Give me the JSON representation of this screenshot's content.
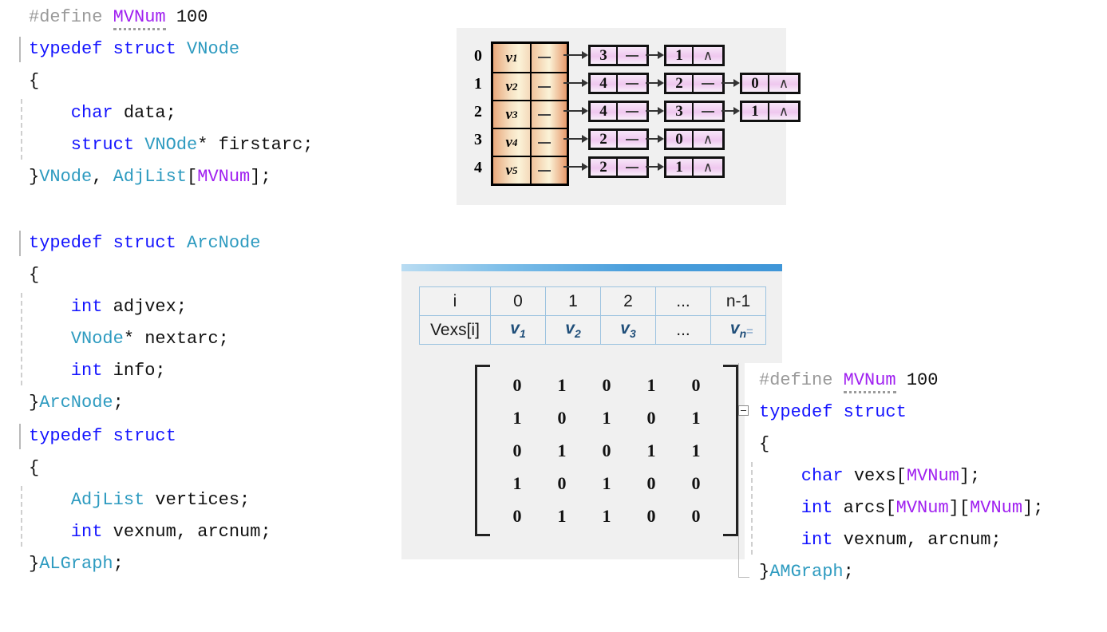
{
  "code_blocks": {
    "vnode": {
      "id": "vnode-struct",
      "lines": [
        {
          "tokens": [
            {
              "t": "#define ",
              "c": "pp"
            },
            {
              "t": "MVNum",
              "c": "macro squig"
            },
            {
              "t": " 100",
              "c": "num"
            }
          ]
        },
        {
          "tokens": [
            {
              "t": "typedef struct ",
              "c": "kw"
            },
            {
              "t": "VNode",
              "c": "typ"
            }
          ],
          "gutter": "bar"
        },
        {
          "tokens": [
            {
              "t": "{",
              "c": "plain"
            }
          ]
        },
        {
          "tokens": [
            {
              "t": "    char",
              "c": "kw"
            },
            {
              "t": " data;",
              "c": "plain"
            }
          ],
          "gutter": "guide"
        },
        {
          "tokens": [
            {
              "t": "    struct ",
              "c": "kw"
            },
            {
              "t": "VNOde",
              "c": "typ"
            },
            {
              "t": "* firstarc;",
              "c": "plain"
            }
          ],
          "gutter": "guide"
        },
        {
          "tokens": [
            {
              "t": "}",
              "c": "plain"
            },
            {
              "t": "VNode",
              "c": "typ"
            },
            {
              "t": ", ",
              "c": "plain"
            },
            {
              "t": "AdjList",
              "c": "typ"
            },
            {
              "t": "[",
              "c": "plain"
            },
            {
              "t": "MVNum",
              "c": "macro"
            },
            {
              "t": "];",
              "c": "plain"
            }
          ]
        }
      ]
    },
    "arcnode": {
      "id": "arcnode-struct",
      "lines": [
        {
          "tokens": [
            {
              "t": "typedef struct ",
              "c": "kw"
            },
            {
              "t": "ArcNode",
              "c": "typ"
            }
          ],
          "gutter": "bar"
        },
        {
          "tokens": [
            {
              "t": "{",
              "c": "plain"
            }
          ]
        },
        {
          "tokens": [
            {
              "t": "    int",
              "c": "kw"
            },
            {
              "t": " adjvex;",
              "c": "plain"
            }
          ],
          "gutter": "guide"
        },
        {
          "tokens": [
            {
              "t": "    ",
              "c": "plain"
            },
            {
              "t": "VNode",
              "c": "typ"
            },
            {
              "t": "* nextarc;",
              "c": "plain"
            }
          ],
          "gutter": "guide"
        },
        {
          "tokens": [
            {
              "t": "    int",
              "c": "kw"
            },
            {
              "t": " info;",
              "c": "plain"
            }
          ],
          "gutter": "guide"
        },
        {
          "tokens": [
            {
              "t": "}",
              "c": "plain"
            },
            {
              "t": "ArcNode",
              "c": "typ"
            },
            {
              "t": ";",
              "c": "plain"
            }
          ]
        }
      ]
    },
    "algraph": {
      "id": "algraph-struct",
      "lines": [
        {
          "tokens": [
            {
              "t": "typedef struct",
              "c": "kw"
            }
          ],
          "gutter": "bar"
        },
        {
          "tokens": [
            {
              "t": "{",
              "c": "plain"
            }
          ]
        },
        {
          "tokens": [
            {
              "t": "    ",
              "c": "plain"
            },
            {
              "t": "AdjList",
              "c": "typ"
            },
            {
              "t": " vertices;",
              "c": "plain"
            }
          ],
          "gutter": "guide"
        },
        {
          "tokens": [
            {
              "t": "    int",
              "c": "kw"
            },
            {
              "t": " vexnum, arcnum;",
              "c": "plain"
            }
          ],
          "gutter": "guide"
        },
        {
          "tokens": [
            {
              "t": "}",
              "c": "plain"
            },
            {
              "t": "ALGraph",
              "c": "typ"
            },
            {
              "t": ";",
              "c": "plain"
            }
          ]
        }
      ]
    },
    "amgraph": {
      "id": "amgraph-struct",
      "lines": [
        {
          "tokens": [
            {
              "t": "#define ",
              "c": "pp"
            },
            {
              "t": "MVNum",
              "c": "macro squig"
            },
            {
              "t": " 100",
              "c": "num"
            }
          ]
        },
        {
          "tokens": [
            {
              "t": "typedef struct",
              "c": "kw"
            }
          ],
          "gutter": "fold"
        },
        {
          "tokens": [
            {
              "t": "{",
              "c": "plain"
            }
          ]
        },
        {
          "tokens": [
            {
              "t": "    char",
              "c": "kw"
            },
            {
              "t": " vexs",
              "c": "plain"
            },
            {
              "t": "[",
              "c": "plain"
            },
            {
              "t": "MVNum",
              "c": "macro"
            },
            {
              "t": "];",
              "c": "plain"
            }
          ],
          "gutter": "guide"
        },
        {
          "tokens": [
            {
              "t": "    int",
              "c": "kw"
            },
            {
              "t": " arcs",
              "c": "plain"
            },
            {
              "t": "[",
              "c": "plain"
            },
            {
              "t": "MVNum",
              "c": "macro"
            },
            {
              "t": "][",
              "c": "plain"
            },
            {
              "t": "MVNum",
              "c": "macro"
            },
            {
              "t": "];",
              "c": "plain"
            }
          ],
          "gutter": "guide"
        },
        {
          "tokens": [
            {
              "t": "    int",
              "c": "kw"
            },
            {
              "t": " vexnum, arcnum;",
              "c": "plain"
            }
          ],
          "gutter": "guide"
        },
        {
          "tokens": [
            {
              "t": "}",
              "c": "plain"
            },
            {
              "t": "AMGraph",
              "c": "typ"
            },
            {
              "t": ";",
              "c": "plain"
            }
          ]
        }
      ]
    }
  },
  "adjacency_list": {
    "title": "adjacency-list-diagram",
    "indices": [
      "0",
      "1",
      "2",
      "3",
      "4"
    ],
    "vertices": [
      "v1",
      "v2",
      "v3",
      "v4",
      "v5"
    ],
    "vertex_labels": [
      {
        "base": "v",
        "sub": "1"
      },
      {
        "base": "v",
        "sub": "2"
      },
      {
        "base": "v",
        "sub": "3"
      },
      {
        "base": "v",
        "sub": "4"
      },
      {
        "base": "v",
        "sub": "5"
      }
    ],
    "rows": [
      {
        "index": "0",
        "vertex_base": "v",
        "vertex_sub": "1",
        "nodes": [
          {
            "adjvex": "3",
            "next": "link"
          },
          {
            "adjvex": "1",
            "next": "∧"
          }
        ]
      },
      {
        "index": "1",
        "vertex_base": "v",
        "vertex_sub": "2",
        "nodes": [
          {
            "adjvex": "4",
            "next": "link"
          },
          {
            "adjvex": "2",
            "next": "link"
          },
          {
            "adjvex": "0",
            "next": "∧"
          }
        ]
      },
      {
        "index": "2",
        "vertex_base": "v",
        "vertex_sub": "3",
        "nodes": [
          {
            "adjvex": "4",
            "next": "link"
          },
          {
            "adjvex": "3",
            "next": "link"
          },
          {
            "adjvex": "1",
            "next": "∧"
          }
        ]
      },
      {
        "index": "3",
        "vertex_base": "v",
        "vertex_sub": "4",
        "nodes": [
          {
            "adjvex": "2",
            "next": "link"
          },
          {
            "adjvex": "0",
            "next": "∧"
          }
        ]
      },
      {
        "index": "4",
        "vertex_base": "v",
        "vertex_sub": "5",
        "nodes": [
          {
            "adjvex": "2",
            "next": "link"
          },
          {
            "adjvex": "1",
            "next": "∧"
          }
        ]
      }
    ]
  },
  "vexs_table": {
    "header": [
      "i",
      "0",
      "1",
      "2",
      "...",
      "n-1"
    ],
    "row": [
      {
        "text": "Vexs[i]",
        "italic": false
      },
      {
        "base": "v",
        "sub": "1",
        "italic": true
      },
      {
        "base": "v",
        "sub": "2",
        "italic": true
      },
      {
        "base": "v",
        "sub": "3",
        "italic": true
      },
      {
        "text": "...",
        "italic": false
      },
      {
        "base": "v",
        "sub": "n",
        "italic": true
      }
    ],
    "equals_mark": "="
  },
  "adjacency_matrix": {
    "rows": 5,
    "cols": 5,
    "values": [
      [
        0,
        1,
        0,
        1,
        0
      ],
      [
        1,
        0,
        1,
        0,
        1
      ],
      [
        0,
        1,
        0,
        1,
        1
      ],
      [
        1,
        0,
        1,
        0,
        0
      ],
      [
        0,
        1,
        1,
        0,
        0
      ]
    ]
  },
  "colors": {
    "keyword": "#1414ff",
    "type": "#2e9bc0",
    "macro": "#a020f0",
    "preprocessor": "#9a9a9a",
    "panel_bg": "#f0f0f0",
    "table_border": "#9cc3e0",
    "vexs_value": "#1f4e79",
    "blue_bar": "#3f96d8"
  }
}
